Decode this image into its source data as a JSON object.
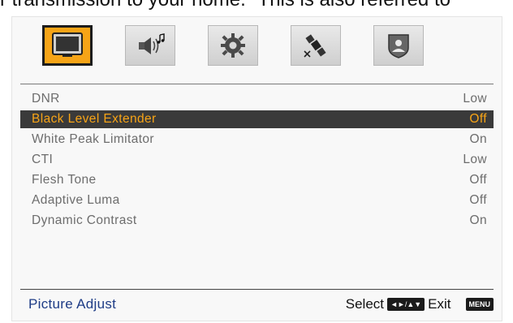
{
  "page_header_text": "r transmission to your home.\" This is also referred to",
  "tabs": [
    {
      "icon": "tv-picture-icon",
      "active": true
    },
    {
      "icon": "speaker-music-icon",
      "active": false
    },
    {
      "icon": "gear-icon",
      "active": false
    },
    {
      "icon": "satellite-icon",
      "active": false
    },
    {
      "icon": "lock-shield-icon",
      "active": false
    }
  ],
  "menu": {
    "items": [
      {
        "label": "DNR",
        "value": "Low",
        "selected": false
      },
      {
        "label": "Black  Level  Extender",
        "value": "Off",
        "selected": true
      },
      {
        "label": "White  Peak  Limitator",
        "value": "On",
        "selected": false
      },
      {
        "label": "CTI",
        "value": "Low",
        "selected": false
      },
      {
        "label": "Flesh  Tone",
        "value": "Off",
        "selected": false
      },
      {
        "label": "Adaptive  Luma",
        "value": "Off",
        "selected": false
      },
      {
        "label": "Dynamic Contrast",
        "value": "On",
        "selected": false
      }
    ]
  },
  "footer": {
    "title": "Picture  Adjust",
    "select_label": "Select",
    "nav_keys": "◄►/▲▼",
    "exit_label": "Exit",
    "menu_key": "MENU"
  },
  "colors": {
    "highlight": "#f7a417",
    "selected_row_bg": "#3a3a3a",
    "footer_title": "#1e3c86"
  }
}
